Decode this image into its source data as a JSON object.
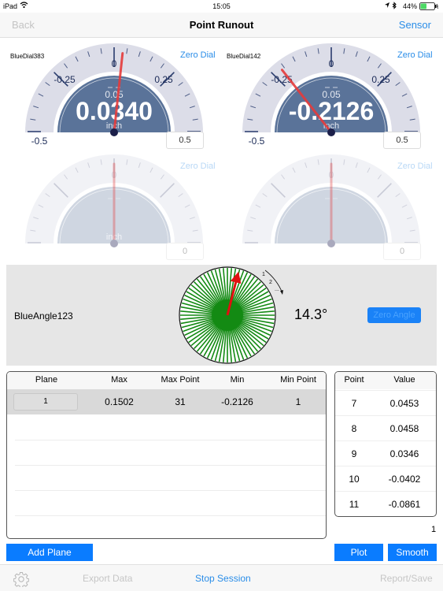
{
  "status_bar": {
    "device": "iPad",
    "wifi_icon": "wifi-icon",
    "time": "15:05",
    "location_icon": "location-arrow-icon",
    "bluetooth_icon": "bluetooth-icon",
    "battery_percent": "44%",
    "battery_level": 0.44,
    "charging_icon": "charging-bolt-icon"
  },
  "nav": {
    "back_label": "Back",
    "title": "Point Runout",
    "sensor_label": "Sensor"
  },
  "dials": [
    {
      "name": "BlueDial383",
      "zero_label": "Zero Dial",
      "reading": "0.0340",
      "reading_value": 0.034,
      "unit": "inch",
      "resolution": "0.05",
      "scale_min": "-0.5",
      "scale_max": "0.5",
      "tick_minus": "-0.25",
      "tick_zero": "0",
      "tick_plus": "0.25",
      "range_value": "0.5",
      "active": true
    },
    {
      "name": "BlueDial142",
      "zero_label": "Zero Dial",
      "reading": "-0.2126",
      "reading_value": -0.2126,
      "unit": "inch",
      "resolution": "0.05",
      "scale_min": "-0.5",
      "scale_max": "0.5",
      "tick_minus": "-0.25",
      "tick_zero": "0",
      "tick_plus": "0.25",
      "range_value": "0.5",
      "active": true
    },
    {
      "name": "",
      "zero_label": "Zero Dial",
      "reading": "",
      "reading_value": 0,
      "unit": "inch",
      "tick_zero": "0",
      "range_value": "0",
      "active": false
    },
    {
      "name": "",
      "zero_label": "Zero Dial",
      "reading": "",
      "reading_value": 0,
      "unit": "",
      "tick_zero": "0",
      "range_value": "0",
      "active": false
    }
  ],
  "angle": {
    "sensor_name": "BlueAngle123",
    "value_label": "14.3°",
    "value_deg": 14.3,
    "direction_labels": [
      "1",
      "2",
      "..."
    ],
    "zero_button": "Zero Angle"
  },
  "plane_table": {
    "columns": [
      "Plane",
      "Max",
      "Max Point",
      "Min",
      "Min Point"
    ],
    "rows": [
      {
        "plane": "1",
        "max": "0.1502",
        "max_point": "31",
        "min": "-0.2126",
        "min_point": "1"
      }
    ]
  },
  "point_table": {
    "columns": [
      "Point",
      "Value"
    ],
    "rows": [
      {
        "point": "7",
        "value": "0.0453"
      },
      {
        "point": "8",
        "value": "0.0458"
      },
      {
        "point": "9",
        "value": "0.0346"
      },
      {
        "point": "10",
        "value": "-0.0402"
      },
      {
        "point": "11",
        "value": "-0.0861"
      }
    ],
    "page": "1"
  },
  "buttons": {
    "add_plane": "Add Plane",
    "plot": "Plot",
    "smooth": "Smooth"
  },
  "toolbar": {
    "settings_icon": "gear-icon",
    "export": "Export Data",
    "stop": "Stop Session",
    "report": "Report/Save"
  },
  "colors": {
    "accent": "#2a8de8",
    "button_blue": "#0a7cff",
    "dial_face": "#5a7399",
    "dial_track": "#dcdde8",
    "needle": "#e53b3b",
    "angle_green": "#138a13"
  }
}
